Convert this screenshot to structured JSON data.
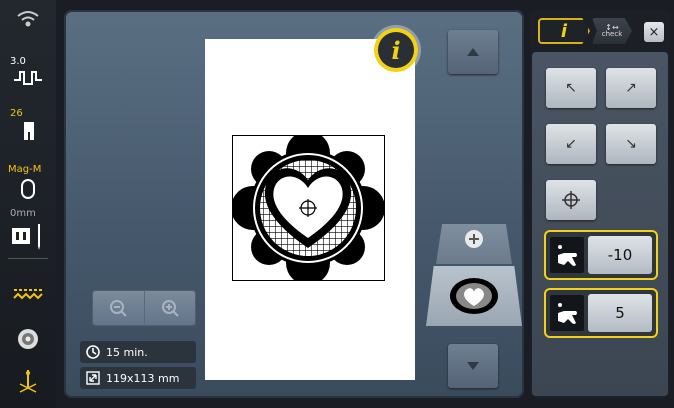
{
  "sidebar": {
    "stitch_width_value": "3.0",
    "presser_foot_value": "26",
    "hoop_name": "Mag-M",
    "needle_offset_value": "0mm"
  },
  "info_button": {
    "label": "i"
  },
  "status": {
    "time": "15 min.",
    "size": "119x113 mm"
  },
  "tabs": {
    "info_label": "i",
    "check_label": "check",
    "close_label": "×"
  },
  "controls": {
    "value_1": "-10",
    "value_2": "5"
  },
  "colors": {
    "accent": "#f2d116",
    "panel": "#4a5563"
  }
}
